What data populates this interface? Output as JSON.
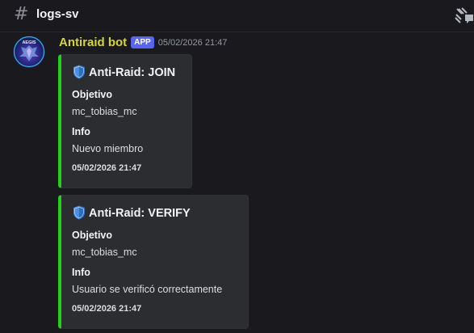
{
  "channel": {
    "name": "logs-sv",
    "hash_symbol": "#"
  },
  "message": {
    "author": "Antiraid bot",
    "badge": "APP",
    "timestamp": "05/02/2026 21:47",
    "avatar_text": "AEGIS",
    "author_color": "#d6d632"
  },
  "embeds": [
    {
      "title": "Anti-Raid: JOIN",
      "fields": [
        {
          "name": "Objetivo",
          "value": "mc_tobias_mc"
        },
        {
          "name": "Info",
          "value": "Nuevo miembro"
        }
      ],
      "footer": "05/02/2026 21:47",
      "accent_color": "#23d11a"
    },
    {
      "title": "Anti-Raid: VERIFY",
      "fields": [
        {
          "name": "Objetivo",
          "value": "mc_tobias_mc"
        },
        {
          "name": "Info",
          "value": "Usuario se verificó correctamente"
        }
      ],
      "footer": "05/02/2026 21:47",
      "accent_color": "#23d11a"
    }
  ],
  "icons": {
    "channel": "hashtag-icon",
    "threads": "threads-icon",
    "title": "shield-icon"
  }
}
